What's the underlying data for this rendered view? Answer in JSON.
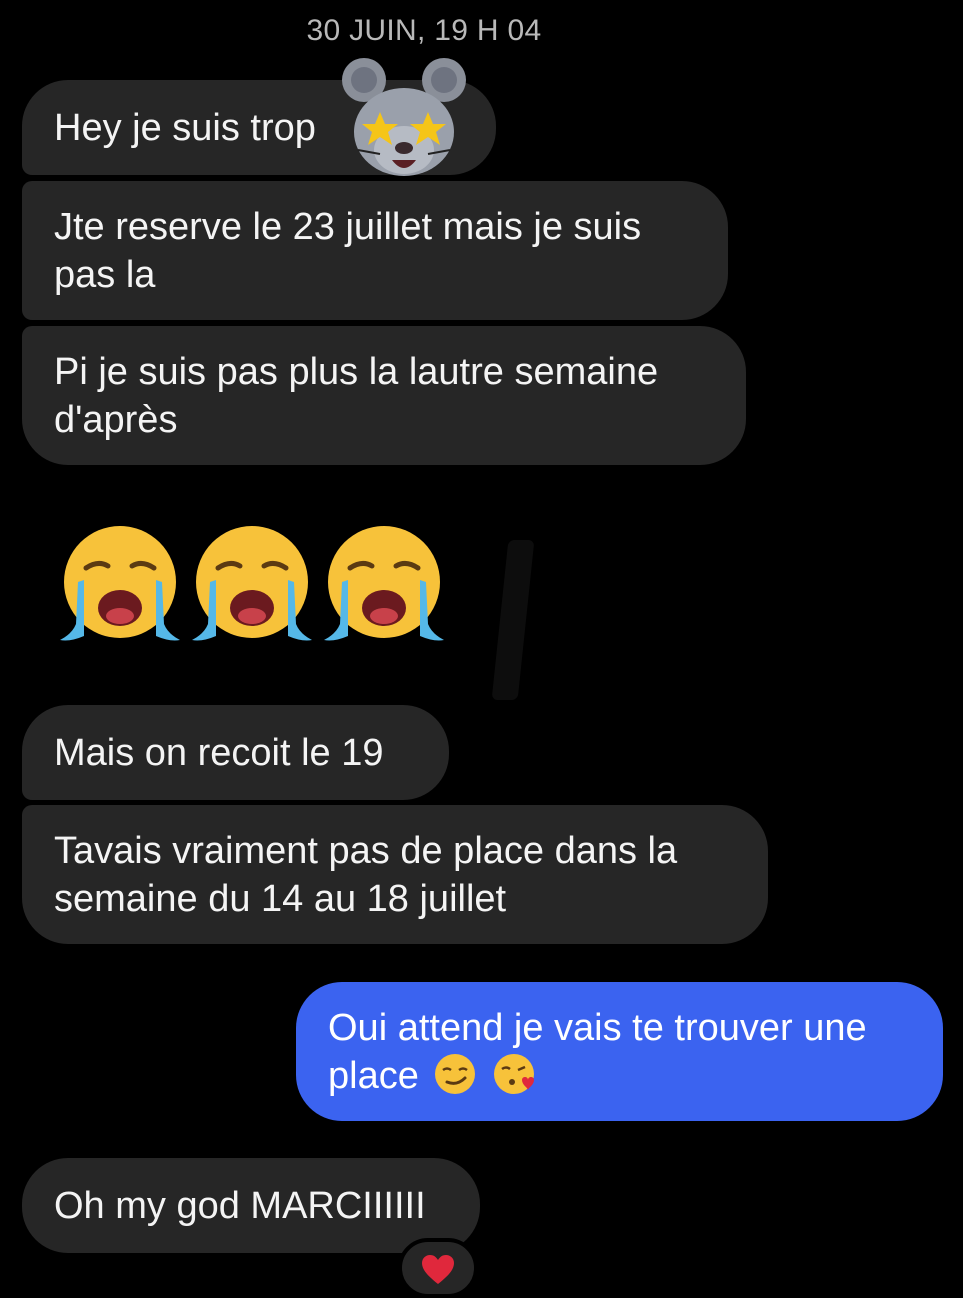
{
  "conversation": {
    "timestamp": "30 JUIN, 19 H 04",
    "messages": [
      {
        "from": "contact",
        "text": "Hey je suis trop",
        "sticker": "mouse-star-eyes-memoji"
      },
      {
        "from": "contact",
        "text": "Jte reserve le 23 juillet mais je suis pas la"
      },
      {
        "from": "contact",
        "text": "Pi je suis pas plus la lautre semaine d'après"
      },
      {
        "from": "contact",
        "emojis": [
          "loudly-crying-face",
          "loudly-crying-face",
          "loudly-crying-face"
        ]
      },
      {
        "from": "contact",
        "text": "Mais on recoit le 19"
      },
      {
        "from": "contact",
        "text": "Tavais vraiment pas de place dans la semaine du 14 au 18 juillet"
      },
      {
        "from": "me",
        "text": "Oui attend je vais te trouver une place",
        "emojis": [
          "smirking-face",
          "face-blowing-kiss"
        ]
      },
      {
        "from": "contact",
        "text": "Oh my god MARCIIIIII",
        "reaction": "red-heart"
      }
    ]
  },
  "colors": {
    "background": "#000000",
    "incoming_bubble": "#262626",
    "outgoing_bubble": "#3b63f0",
    "timestamp_text": "#b9b9b9",
    "reaction_heart": "#e0283c"
  }
}
